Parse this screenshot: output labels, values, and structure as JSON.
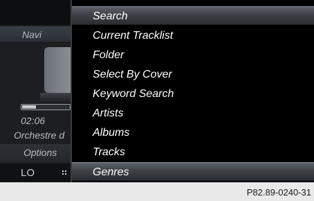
{
  "background_screen": {
    "navi_label": "Navi",
    "track_time": "02:06",
    "progress_fraction": 0.3,
    "artist": "Orchestre d",
    "options_label": "Options",
    "sound_label": "LO"
  },
  "menu": {
    "items": [
      {
        "label": "Search",
        "selected": true
      },
      {
        "label": "Current Tracklist",
        "selected": false
      },
      {
        "label": "Folder",
        "selected": false
      },
      {
        "label": "Select By Cover",
        "selected": false
      },
      {
        "label": "Keyword Search",
        "selected": false
      },
      {
        "label": "Artists",
        "selected": false
      },
      {
        "label": "Albums",
        "selected": false
      },
      {
        "label": "Tracks",
        "selected": false
      },
      {
        "label": "Genres",
        "selected": true
      }
    ]
  },
  "caption": "P82.89-0240-31"
}
